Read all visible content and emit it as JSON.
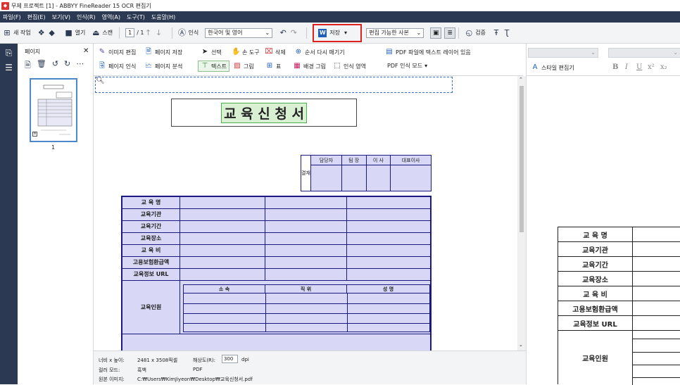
{
  "window": {
    "title": "무제 프로젝트 [1] - ABBYY FineReader 15 OCR 편집기"
  },
  "menu": [
    "파일(F)",
    "편집(E)",
    "보기(V)",
    "인식(R)",
    "영역(A)",
    "도구(T)",
    "도움말(H)"
  ],
  "toolbar": {
    "new_task": "새 작업",
    "open": "열기",
    "scan": "스캔",
    "page_current": "1",
    "page_total": "/ 1",
    "recognize": "인식",
    "language": "한국어 및 영어",
    "save": "저장",
    "save_format": "편집 가능한 사본",
    "verify": "검증",
    "brand_color": "#2b3a52",
    "highlight_color": "#e0201d"
  },
  "pages_panel": {
    "title": "페이지",
    "thumbnail_number": "1"
  },
  "ribbon": {
    "edit_image": "이미지 편집",
    "save_page": "페이지 저장",
    "select": "선택",
    "hand_tool": "손 도구",
    "delete": "삭제",
    "reorder": "순서 다시 매기기",
    "text_layer": "PDF 파일에 텍스트 레이어 있음",
    "recognize_page": "페이지 인식",
    "analyze_page": "페이지 분석",
    "text": "텍스트",
    "picture": "그림",
    "table": "표",
    "background_picture": "배경 그림",
    "recognition_area": "인식 영역",
    "pdf_mode": "PDF 인식 모드"
  },
  "document": {
    "title": "교 육 신 청 서",
    "approval": {
      "side_label": "결재",
      "headers": [
        "담당자",
        "팀 장",
        "이 사",
        "대표이사"
      ]
    },
    "rows": [
      "교 육 명",
      "교육기관",
      "교육기간",
      "교육장소",
      "교 육 비",
      "고용보험환급액",
      "교육정보 URL"
    ],
    "personnel_label": "교육인원",
    "personnel_headers": [
      "소 속",
      "직 위",
      "성 명"
    ]
  },
  "status": {
    "size_label": "너비 x 높이:",
    "size_value": "2481 x 3508픽셀",
    "resolution_label": "해상도(R):",
    "resolution_value": "300",
    "resolution_unit": "dpi",
    "color_label": "컬러 모드:",
    "color_value": "흑백",
    "source_label": "원본 이미지:",
    "source_type": "PDF",
    "source_path": "C:₩Users₩KimJiyeon₩Desktop₩교육신청서.pdf"
  },
  "right_panel": {
    "style_editor": "스타일 편집기",
    "rows": [
      "교 육 명",
      "교육기관",
      "교육기간",
      "교육장소",
      "교 육 비",
      "고용보험환급액",
      "교육정보 URL"
    ],
    "personnel_label": "교육인원"
  }
}
